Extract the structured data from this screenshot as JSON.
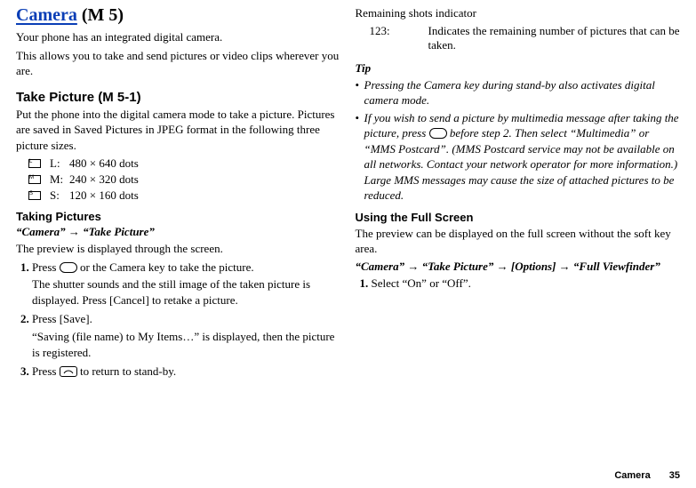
{
  "title": {
    "main": "Camera",
    "menu_ref": "(M 5)"
  },
  "intro": {
    "line1": "Your phone has an integrated digital camera.",
    "line2": "This allows you to take and send pictures or video clips wherever you are."
  },
  "take_picture": {
    "heading": "Take Picture (M 5-1)",
    "desc": "Put the phone into the digital camera mode to take a picture. Pictures are saved in Saved Pictures in JPEG format in the following three picture sizes.",
    "sizes": [
      {
        "letter": "L",
        "label": "L:",
        "value": "480 × 640 dots"
      },
      {
        "letter": "M",
        "label": "M:",
        "value": "240 × 320 dots"
      },
      {
        "letter": "S",
        "label": "S:",
        "value": "120 × 160 dots"
      }
    ]
  },
  "taking_pictures": {
    "heading": "Taking Pictures",
    "path": "“Camera” → “Take Picture”",
    "preview": "The preview is displayed through the screen.",
    "steps": [
      {
        "main_before": "Press ",
        "main_after": " or the Camera key to take the picture.",
        "sub": "The shutter sounds and the still image of the taken picture is displayed. Press [Cancel] to retake a picture."
      },
      {
        "main": "Press [Save].",
        "sub": "“Saving (file name) to My Items…” is displayed, then the picture is registered."
      },
      {
        "main_before": "Press ",
        "main_after": " to return to stand-by."
      }
    ]
  },
  "remaining": {
    "heading": "Remaining shots indicator",
    "label": "123:",
    "desc": "Indicates the remaining number of pictures that can be taken."
  },
  "tip": {
    "heading": "Tip",
    "items": [
      "Pressing the Camera key during stand-by also activates digital camera mode.",
      {
        "before": "If you wish to send a picture by multimedia message after taking the picture, press ",
        "after": " before step 2. Then select “Multimedia” or “MMS Postcard”. (MMS Postcard service may not be available on all networks. Contact your network operator for more information.) Large MMS messages may cause the size of attached pictures to be reduced."
      }
    ]
  },
  "full_screen": {
    "heading": "Using the Full Screen",
    "desc": "The preview can be displayed on the full screen without the soft key area.",
    "path": " “Camera” → “Take Picture” → [Options] → “Full Viewfinder”",
    "step": "Select “On” or “Off”."
  },
  "footer": {
    "label": "Camera",
    "page": "35"
  }
}
